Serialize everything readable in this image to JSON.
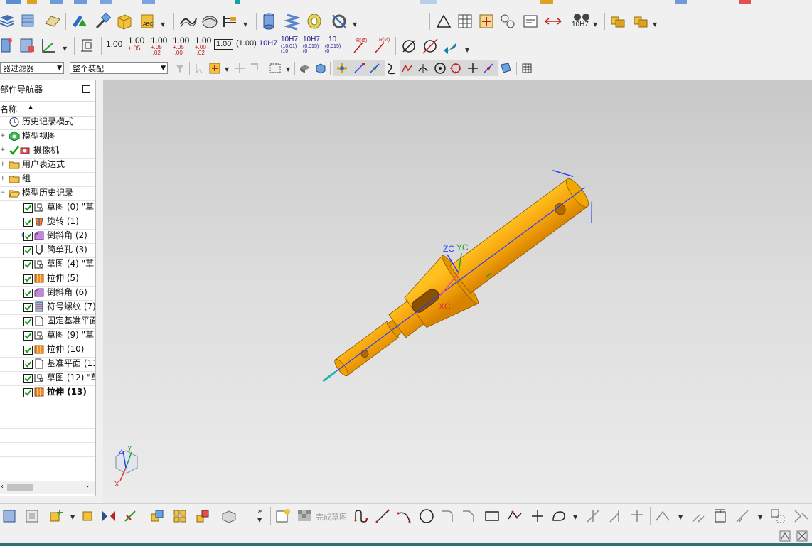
{
  "toolbar": {
    "dimensions": {
      "d1": "1.00",
      "d2_main": "1.00",
      "d2_tol": "±.05",
      "d3_main": "1.00",
      "d3_tol_up": "+.05",
      "d3_tol_dn": "-.02",
      "d4_main": "1.00",
      "d4_tol_up": "+.05",
      "d4_tol_dn": "-.00",
      "d5_main": "1.00",
      "d5_tol_up": "+.00",
      "d5_tol_dn": "-.02",
      "d6": "1.00",
      "d7": "(1.00)",
      "d8": "10H7",
      "d9_main": "10H7",
      "d9_sub": "(10.01)",
      "d9_sub2": "(10",
      "d10_main": "10H7",
      "d10_sub": "(0.015)",
      "d10_sub2": "(0",
      "d11_main": "10",
      "d11_sub": "(0.015)",
      "d11_sub2": "(0",
      "r1": "R(Ø)",
      "r2": "R(Ø)",
      "fit": "10H7"
    },
    "selection_filter": "器过滤器",
    "assembly_scope": "整个装配"
  },
  "navigator": {
    "title": "部件导航器",
    "column_header": "名称",
    "items": [
      {
        "label": "历史记录模式"
      },
      {
        "label": "模型视图"
      },
      {
        "label": "摄像机"
      },
      {
        "label": "用户表达式"
      },
      {
        "label": "组"
      },
      {
        "label": "模型历史记录"
      },
      {
        "label": "草图 (0) \"草"
      },
      {
        "label": "旋转 (1)"
      },
      {
        "label": "倒斜角 (2)"
      },
      {
        "label": "简单孔 (3)"
      },
      {
        "label": "草图 (4) \"草"
      },
      {
        "label": "拉伸 (5)"
      },
      {
        "label": "倒斜角 (6)"
      },
      {
        "label": "符号螺纹 (7)"
      },
      {
        "label": "固定基准平面"
      },
      {
        "label": "草图 (9) \"草"
      },
      {
        "label": "拉伸 (10)"
      },
      {
        "label": "基准平面 (11"
      },
      {
        "label": "草图 (12) \"草"
      },
      {
        "label": "拉伸 (13)"
      }
    ]
  },
  "viewport": {
    "wcs_labels": {
      "zc": "ZC",
      "yc": "YC",
      "xc": "XC"
    },
    "triad_labels": {
      "x": "X",
      "y": "Y",
      "z": "Z"
    },
    "part_color": "#f2a20c",
    "axis_color": "#2a3cff"
  },
  "sketch_toolbar": {
    "finish_sketch": "完成草图"
  }
}
